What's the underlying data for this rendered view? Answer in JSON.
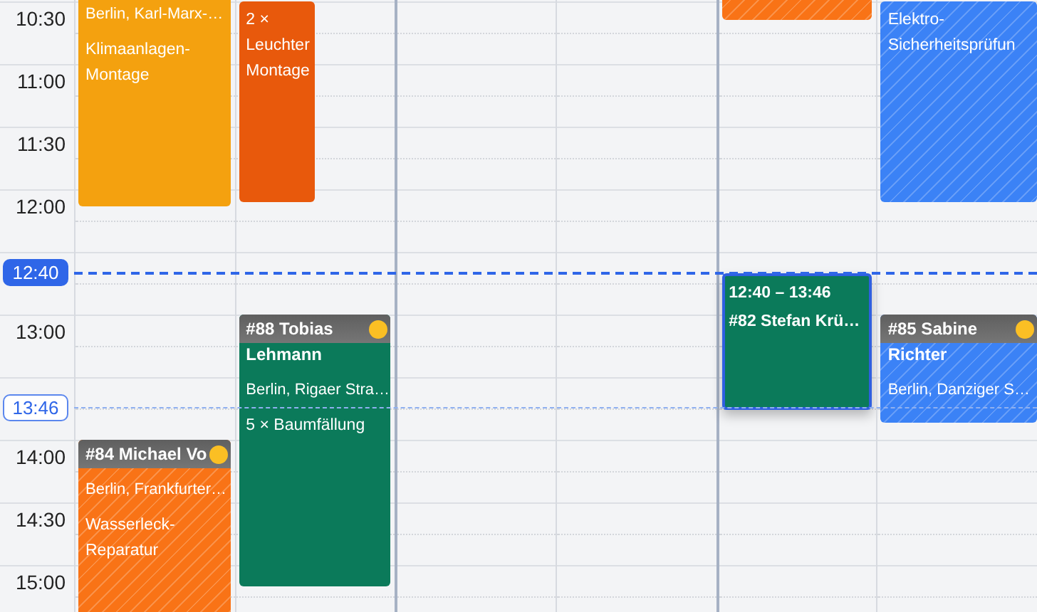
{
  "time_labels": [
    "10:30",
    "11:00",
    "11:30",
    "12:00",
    "13:00",
    "14:00",
    "14:30",
    "15:00"
  ],
  "now_marker": {
    "label": "12:40"
  },
  "cursor_marker": {
    "label": "13:46"
  },
  "events": [
    {
      "color": "#f4a10f",
      "striped": false,
      "selected": false,
      "address": "Berlin, Karl-Marx-…",
      "task": "Klimaanlagen-Montage"
    },
    {
      "color": "#e8590c",
      "striped": false,
      "selected": false,
      "task": "2 × Leuchter Montage"
    },
    {
      "color": "#f97316",
      "striped": true,
      "selected": false
    },
    {
      "color": "#3b82f6",
      "striped": true,
      "selected": false,
      "task": "Elektro-Sicherheitsprüfun"
    },
    {
      "color": "#0b7a5a",
      "striped": false,
      "selected": true,
      "time": "12:40 – 13:46",
      "title": "#82 Stefan Krü…"
    },
    {
      "color": "#0b7a5a",
      "striped": false,
      "selected": false,
      "status": {
        "color": "#fbbf24"
      },
      "title": "#88 Tobias Lehmann",
      "address": "Berlin, Rigaer Stra…",
      "task": "5 × Baumfällung"
    },
    {
      "color": "#3b82f6",
      "striped": true,
      "selected": false,
      "status": {
        "color": "#fbbf24"
      },
      "title": "#85 Sabine Richter",
      "address": "Berlin, Danziger S…"
    },
    {
      "color": "#f97316",
      "striped": true,
      "selected": false,
      "status": {
        "color": "#fbbf24"
      },
      "title": "#84 Michael Vo",
      "address": "Berlin, Frankfurter…",
      "task": "Wasserleck-Reparatur"
    }
  ]
}
